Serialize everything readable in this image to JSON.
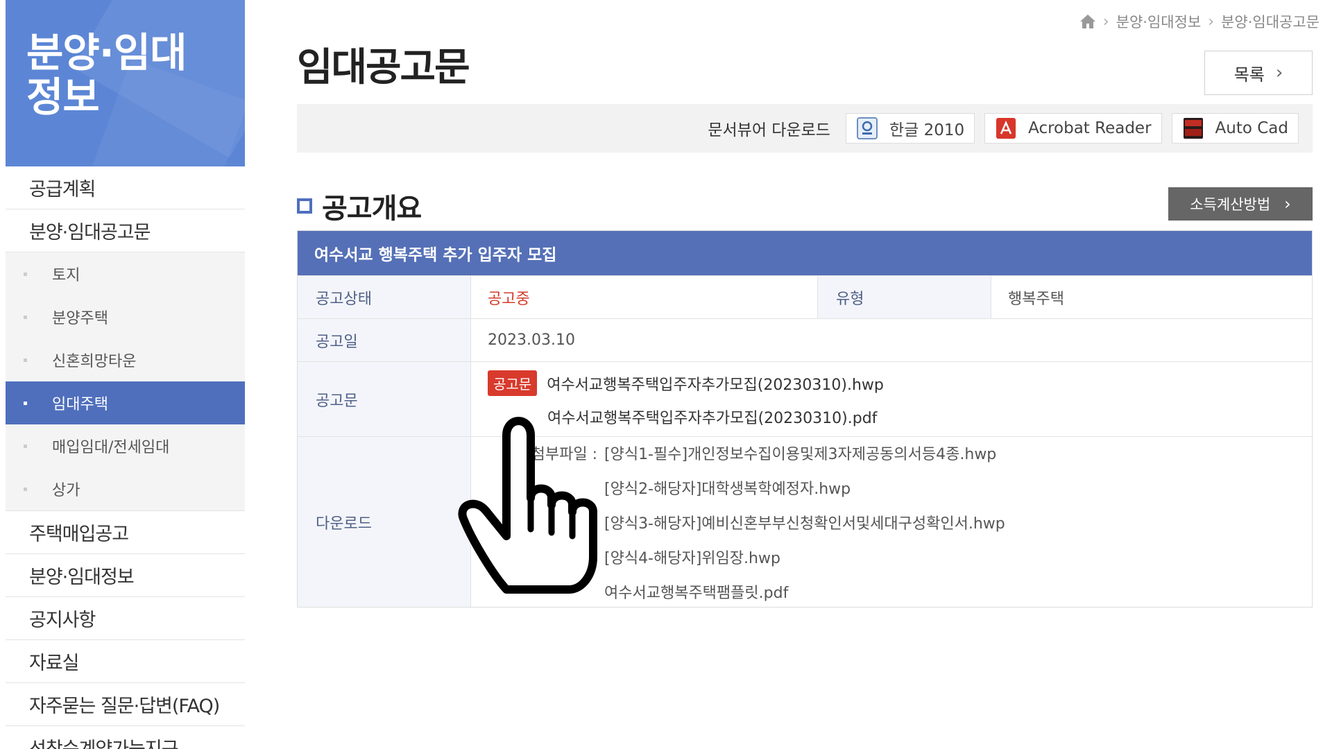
{
  "sidebar": {
    "title_line1": "분양·임대",
    "title_line2": "정보",
    "items_top": [
      "공급계획",
      "분양·임대공고문"
    ],
    "sub_items": [
      "토지",
      "분양주택",
      "신혼희망타운",
      "임대주택",
      "매입임대/전세임대",
      "상가"
    ],
    "active_sub": "임대주택",
    "items_bottom": [
      "주택매입공고",
      "분양·임대정보",
      "공지사항",
      "자료실",
      "자주묻는 질문·답변(FAQ)",
      "선착순계약가능지구"
    ]
  },
  "breadcrumb": {
    "home_icon": "home-icon",
    "items": [
      "분양·임대정보",
      "분양·임대공고문"
    ]
  },
  "page": {
    "title": "임대공고문",
    "list_button": "목록"
  },
  "viewer": {
    "label": "문서뷰어 다운로드",
    "buttons": [
      {
        "label": "한글 2010",
        "icon": "hangul-icon"
      },
      {
        "label": "Acrobat Reader",
        "icon": "acrobat-icon"
      },
      {
        "label": "Auto Cad",
        "icon": "autocad-icon"
      }
    ]
  },
  "section": {
    "title": "공고개요",
    "calc_button": "소득계산방법"
  },
  "notice": {
    "title": "여수서교 행복주택 추가 입주자 모집",
    "status_label": "공고상태",
    "status_value": "공고중",
    "type_label": "유형",
    "type_value": "행복주택",
    "date_label": "공고일",
    "date_value": "2023.03.10",
    "doc_label": "공고문",
    "doc_badge": "공고문",
    "doc_files": [
      "여수서교행복주택입주자추가모집(20230310).hwp",
      "여수서교행복주택입주자추가모집(20230310).pdf"
    ],
    "download_label": "다운로드",
    "attach_label": "첨부파일 :",
    "attach_files": [
      "[양식1-필수]개인정보수집이용및제3자제공동의서등4종.hwp",
      "[양식2-해당자]대학생복학예정자.hwp",
      "[양식3-해당자]예비신혼부부신청확인서및세대구성확인서.hwp",
      "[양식4-해당자]위임장.hwp",
      "여수서교행복주택팸플릿.pdf"
    ]
  },
  "colors": {
    "sidebar_head": "#5c86d5",
    "accent": "#4f6fbd",
    "table_head": "#5570b7",
    "status_red": "#d33c2b"
  }
}
